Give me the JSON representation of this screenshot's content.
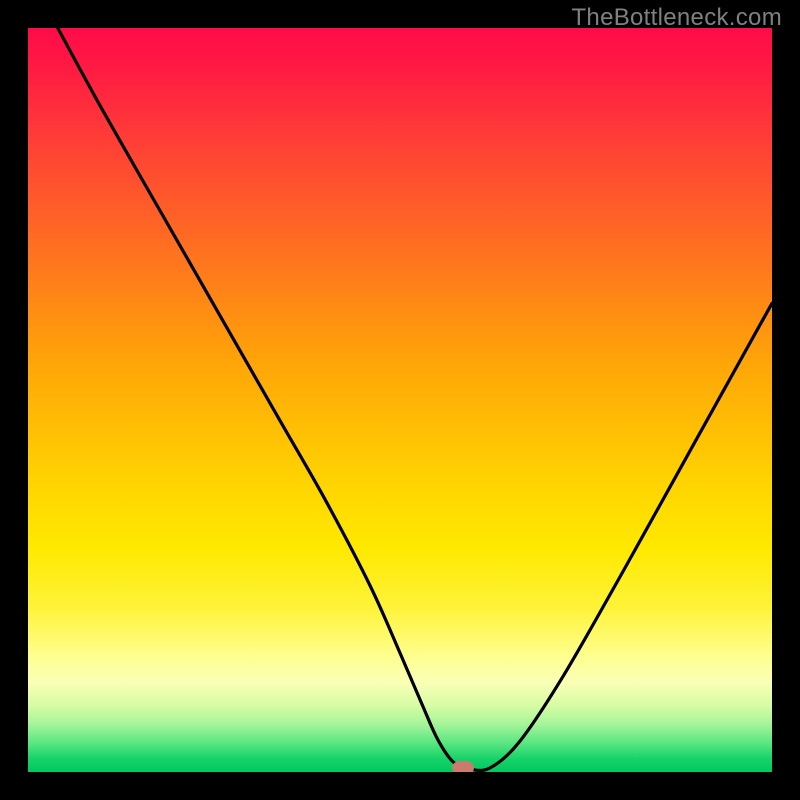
{
  "watermark": "TheBottleneck.com",
  "chart_data": {
    "type": "line",
    "title": "",
    "xlabel": "",
    "ylabel": "",
    "xlim": [
      0,
      100
    ],
    "ylim": [
      0,
      100
    ],
    "grid": false,
    "series": [
      {
        "name": "bottleneck-curve",
        "x": [
          4,
          10,
          18,
          26,
          34,
          40,
          46,
          50,
          53,
          55,
          57,
          59,
          62,
          66,
          72,
          80,
          90,
          100
        ],
        "values": [
          100,
          89,
          75,
          61,
          47,
          36.5,
          25,
          16,
          9,
          4.5,
          1.5,
          0.5,
          0.5,
          4,
          13,
          27,
          45,
          63
        ]
      }
    ],
    "marker": {
      "x": 58.5,
      "y": 0.5
    },
    "background_gradient": {
      "top": "#ff0b48",
      "mid": "#ffe900",
      "bottom": "#00c85f"
    }
  }
}
